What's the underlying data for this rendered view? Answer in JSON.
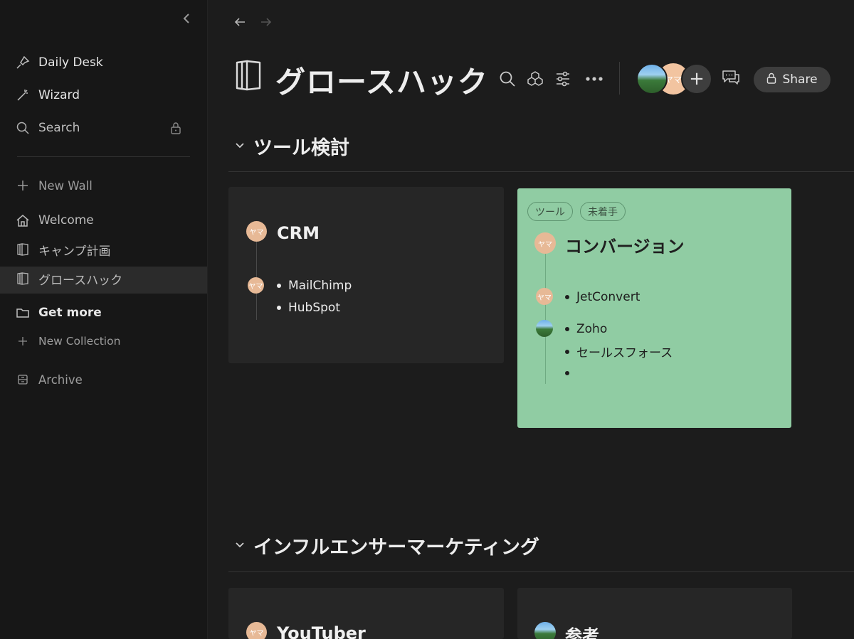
{
  "sidebar": {
    "items": [
      {
        "label": "Daily Desk",
        "icon": "pin-icon"
      },
      {
        "label": "Wizard",
        "icon": "magic-wand-icon"
      },
      {
        "label": "Search",
        "icon": "search-icon"
      }
    ],
    "new_wall": "New Wall",
    "walls": [
      {
        "label": "Welcome",
        "icon": "home-icon"
      },
      {
        "label": "キャンプ計画",
        "icon": "book-icon"
      },
      {
        "label": "グロースハック",
        "icon": "book-icon",
        "selected": true
      }
    ],
    "get_more": "Get more",
    "new_collection": "New Collection",
    "archive": "Archive"
  },
  "header": {
    "title": "グロースハック",
    "share_label": "Share",
    "member_initials": "ヤマ"
  },
  "sections": [
    {
      "title": "ツール検討",
      "cards": [
        {
          "title": "CRM",
          "avatar_text": "ヤマ",
          "items": [
            "MailChimp",
            "HubSpot"
          ]
        },
        {
          "title": "コンバージョン",
          "avatar_text": "ヤマ",
          "tags": [
            "ツール",
            "未着手"
          ],
          "color": "#90cca3",
          "items_group1": [
            "JetConvert"
          ],
          "items_group2": [
            "Zoho",
            "セールスフォース",
            ""
          ]
        }
      ]
    },
    {
      "title": "インフルエンサーマーケティング",
      "cards": [
        {
          "title": "YouTuber",
          "avatar_text": "ヤマ"
        },
        {
          "title": "参考"
        }
      ]
    }
  ]
}
